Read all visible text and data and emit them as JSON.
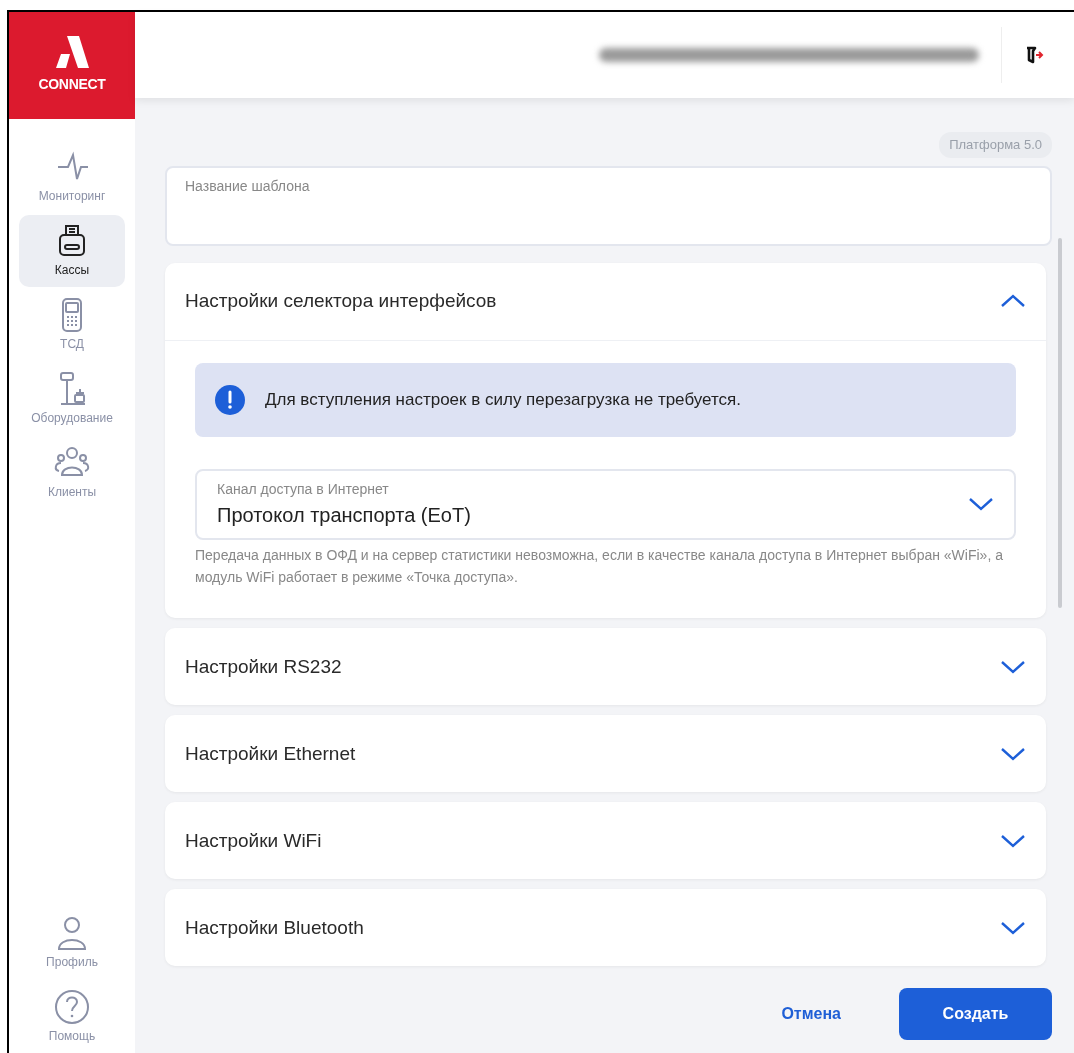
{
  "brand": {
    "logo_text": "CONNECT"
  },
  "nav": [
    {
      "label": "Мониторинг",
      "kind": "pulse",
      "selected": false
    },
    {
      "label": "Кассы",
      "kind": "register",
      "selected": true
    },
    {
      "label": "ТСД",
      "kind": "terminal",
      "selected": false
    },
    {
      "label": "Оборудование",
      "kind": "scale",
      "selected": false
    },
    {
      "label": "Клиенты",
      "kind": "people",
      "selected": false
    }
  ],
  "nav_bottom": [
    {
      "label": "Профиль",
      "kind": "person"
    },
    {
      "label": "Помощь",
      "kind": "help"
    }
  ],
  "platform_badge": "Платформа 5.0",
  "template_name": {
    "placeholder": "Название шаблона"
  },
  "sections": [
    {
      "title": "Настройки селектора интерфейсов",
      "expanded": true,
      "alert": "Для вступления настроек в силу перезагрузка не требуется.",
      "select": {
        "label": "Канал доступа в Интернет",
        "value": "Протокол транспорта (EoT)"
      },
      "help": "Передача данных в ОФД и на сервер статистики невозможна, если в качестве канала доступа в Интернет выбран «WiFi», а модуль WiFi работает в режиме «Точка доступа»."
    },
    {
      "title": "Настройки RS232",
      "expanded": false
    },
    {
      "title": "Настройки Ethernet",
      "expanded": false
    },
    {
      "title": "Настройки WiFi",
      "expanded": false
    },
    {
      "title": "Настройки Bluetooth",
      "expanded": false
    }
  ],
  "buttons": {
    "cancel": "Отмена",
    "create": "Создать"
  }
}
